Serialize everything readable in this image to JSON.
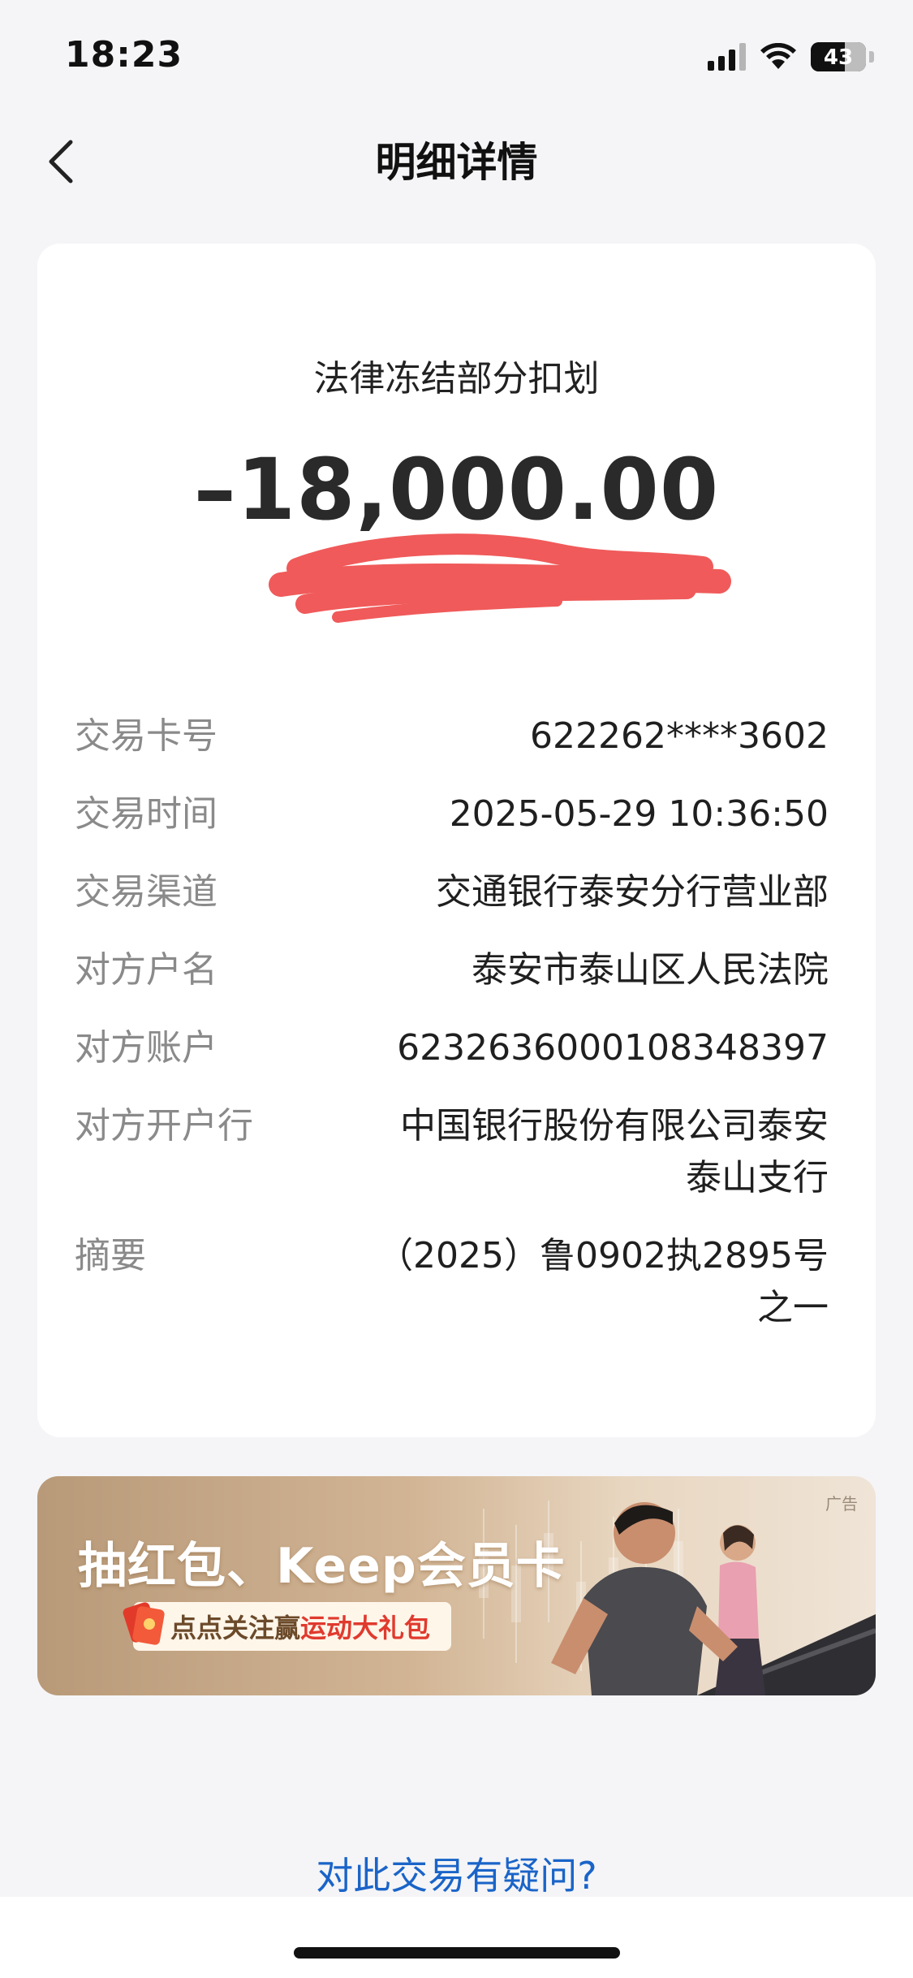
{
  "status_bar": {
    "time": "18:23",
    "battery": "43"
  },
  "nav": {
    "title": "明细详情"
  },
  "transaction": {
    "type": "法律冻结部分扣划",
    "amount": "–18,000.00",
    "details": [
      {
        "label": "交易卡号",
        "value": "622262****3602"
      },
      {
        "label": "交易时间",
        "value": "2025-05-29 10:36:50"
      },
      {
        "label": "交易渠道",
        "value": "交通银行泰安分行营业部"
      },
      {
        "label": "对方户名",
        "value": "泰安市泰山区人民法院"
      },
      {
        "label": "对方账户",
        "value": "6232636000108348397"
      },
      {
        "label": "对方开户行",
        "value": "中国银行股份有限公司泰安泰山支行"
      },
      {
        "label": "摘要",
        "value": "（2025）鲁0902执2895号之一"
      }
    ]
  },
  "ad": {
    "tag": "广告",
    "title": "抽红包、Keep会员卡",
    "subtitle_part1": "点点关注赢",
    "subtitle_part2": "运动大礼包"
  },
  "footer": {
    "question_link": "对此交易有疑问?"
  },
  "colors": {
    "background": "#f5f5f7",
    "card": "#ffffff",
    "link": "#1a64c8",
    "redaction": "#f05a5a"
  }
}
